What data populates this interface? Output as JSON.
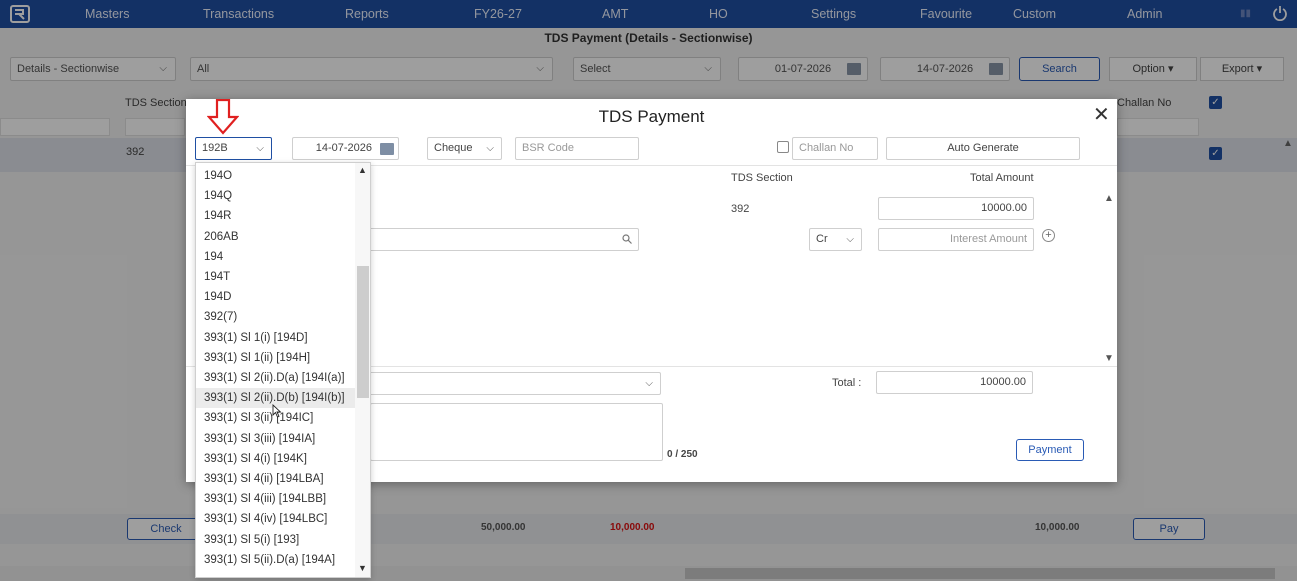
{
  "nav": {
    "items": [
      "Masters",
      "Transactions",
      "Reports",
      "FY26-27",
      "AMT",
      "HO",
      "Settings",
      "Favourite",
      "Custom",
      "Admin"
    ]
  },
  "page": {
    "title": "TDS Payment (Details - Sectionwise)",
    "filters": {
      "mode": "Details - Sectionwise",
      "all": "All",
      "select": "Select",
      "from_date": "01-07-2026",
      "to_date": "14-07-2026"
    },
    "buttons": {
      "search": "Search",
      "option": "Option",
      "export": "Export",
      "check": "Check",
      "pay": "Pay"
    },
    "columns": {
      "tds_section": "TDS Section",
      "challan_no": "Challan No"
    },
    "row": {
      "tds_section": "392"
    },
    "footer": {
      "total1": "50,000.00",
      "total2": "10,000.00",
      "total3": "10,000.00"
    }
  },
  "modal": {
    "title": "TDS Payment",
    "section_select": "192B",
    "date": "14-07-2026",
    "payment_mode": "Cheque",
    "bsr_placeholder": "BSR Code",
    "challan_placeholder": "Challan No",
    "auto_generate": "Auto Generate",
    "grid_headers": {
      "tds_section": "TDS Section",
      "total_amount": "Total Amount"
    },
    "row": {
      "tds_section": "392",
      "amount": "10000.00",
      "crdr": "Cr",
      "interest_placeholder": "Interest Amount"
    },
    "total_label": "Total :",
    "total_value": "10000.00",
    "counter": "0 / 250",
    "payment_button": "Payment"
  },
  "dropdown": {
    "items": [
      "194O",
      "194Q",
      "194R",
      "206AB",
      "194",
      "194T",
      "194D",
      "392(7)",
      "393(1) Sl 1(i) [194D]",
      "393(1) Sl 1(ii) [194H]",
      "393(1) Sl 2(ii).D(a) [194I(a)]",
      "393(1) Sl 2(ii).D(b) [194I(b)]",
      "393(1) Sl 3(ii) [194IC]",
      "393(1) Sl 3(iii) [194IA]",
      "393(1) Sl 4(i) [194K]",
      "393(1) Sl 4(ii) [194LBA]",
      "393(1) Sl 4(iii) [194LBB]",
      "393(1) Sl 4(iv) [194LBC]",
      "393(1) Sl 5(i) [193]",
      "393(1) Sl 5(ii).D(a) [194A]"
    ],
    "highlighted_index": 11
  },
  "colors": {
    "nav": "#1f4fa3",
    "accent": "#2a5bb5",
    "red_total": "#d11",
    "arrow": "#e02020"
  }
}
